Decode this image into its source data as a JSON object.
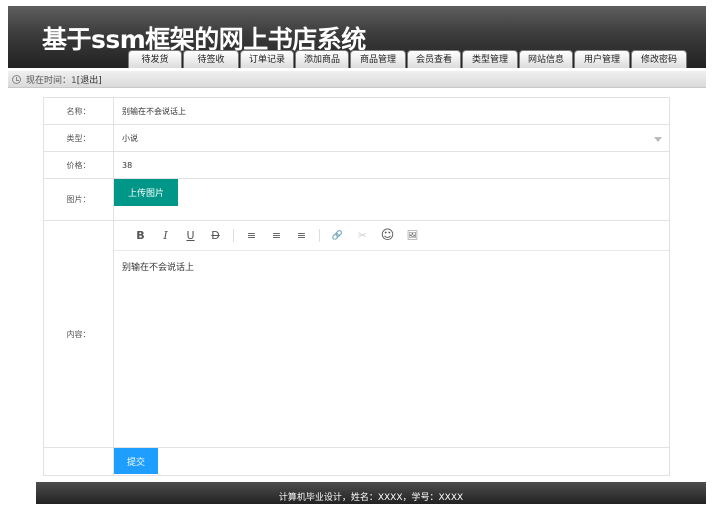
{
  "header": {
    "title": "基于ssm框架的网上书店系统",
    "nav": [
      {
        "label": "待发货",
        "width": 54
      },
      {
        "label": "待签收",
        "width": 56
      },
      {
        "label": "订单记录",
        "width": 54
      },
      {
        "label": "添加商品",
        "width": 54
      },
      {
        "label": "商品管理",
        "width": 56
      },
      {
        "label": "会员查看",
        "width": 54
      },
      {
        "label": "类型管理",
        "width": 56
      },
      {
        "label": "网站信息",
        "width": 54
      },
      {
        "label": "用户管理",
        "width": 56
      },
      {
        "label": "修改密码",
        "width": 56
      }
    ]
  },
  "status": {
    "time_label": "现在时间：1",
    "logout_label": "[退出]"
  },
  "form": {
    "name": {
      "label": "名称：",
      "value": "别输在不会说话上"
    },
    "type": {
      "label": "类型：",
      "value": "小说"
    },
    "price": {
      "label": "价格：",
      "value": "38"
    },
    "image": {
      "label": "图片：",
      "upload_label": "上传图片"
    },
    "content": {
      "label": "内容：",
      "value": "别输在不会说话上"
    },
    "submit_label": "提交"
  },
  "toolbar": {
    "bold": "B",
    "italic": "I",
    "underline": "U",
    "strike": "D",
    "align_left": "≡",
    "align_center": "≡",
    "align_right": "≡",
    "link": "🔗",
    "unlink": "✂",
    "emoji": "☺",
    "image": "🖼"
  },
  "footer": {
    "text": "计算机毕业设计，姓名：XXXX，学号：XXXX"
  }
}
